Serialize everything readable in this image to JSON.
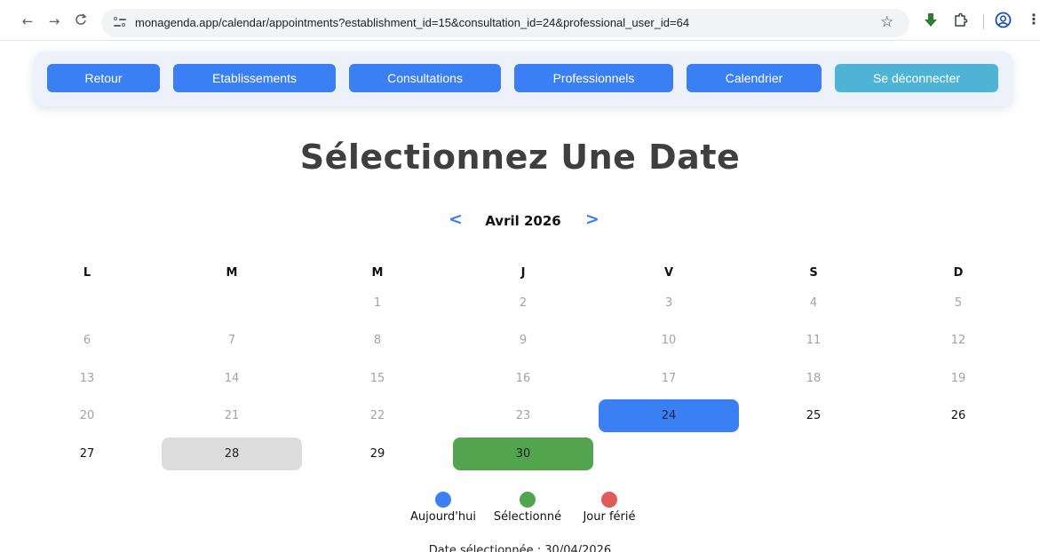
{
  "browser": {
    "url": "monagenda.app/calendar/appointments?establishment_id=15&consultation_id=24&professional_user_id=64",
    "back_icon": "←",
    "forward_icon": "→",
    "reload_icon": "C",
    "star_icon": "☆",
    "more_icon": "⋮"
  },
  "nav": {
    "buttons": [
      "Retour",
      "Etablissements",
      "Consultations",
      "Professionnels",
      "Calendrier",
      "Se déconnecter"
    ]
  },
  "title": "Sélectionnez Une Date",
  "calendar": {
    "prev": "<",
    "next": ">",
    "month": "Avril 2026",
    "weekdays": [
      "L",
      "M",
      "M",
      "J",
      "V",
      "S",
      "D"
    ],
    "weeks": [
      [
        null,
        null,
        "1",
        "2",
        "3",
        "4",
        "5"
      ],
      [
        "6",
        "7",
        "8",
        "9",
        "10",
        "11",
        "12"
      ],
      [
        "13",
        "14",
        "15",
        "16",
        "17",
        "18",
        "19"
      ],
      [
        "20",
        "21",
        "22",
        "23",
        "24",
        "25",
        "26"
      ],
      [
        "27",
        "28",
        "29",
        "30",
        null,
        null,
        null
      ]
    ],
    "today": "24",
    "selected": "30",
    "highlighted": "28",
    "first_available": "24"
  },
  "legend": [
    {
      "label": "Aujourd'hui",
      "color": "#3b7ff5"
    },
    {
      "label": "Sélectionné",
      "color": "#52a44f"
    },
    {
      "label": "Jour férié",
      "color": "#e05c5c"
    }
  ],
  "selected_text": "Date sélectionnée : 30/04/2026"
}
